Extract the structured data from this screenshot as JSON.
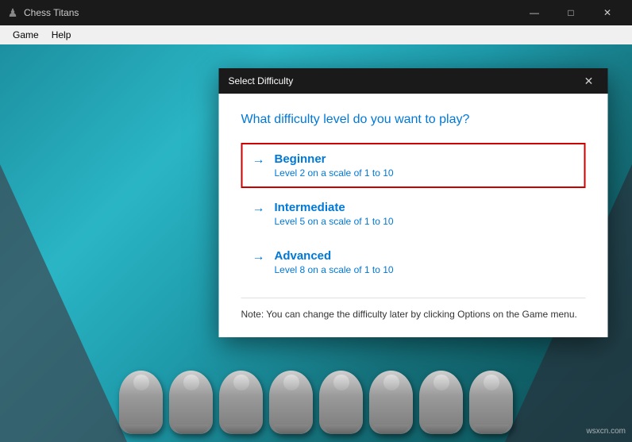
{
  "titleBar": {
    "icon": "♟",
    "title": "Chess Titans",
    "minimizeLabel": "—",
    "maximizeLabel": "□",
    "closeLabel": "✕"
  },
  "menuBar": {
    "items": [
      "Game",
      "Help"
    ]
  },
  "dialog": {
    "title": "Select Difficulty",
    "closeLabel": "✕",
    "question": "What difficulty level do you want to play?",
    "options": [
      {
        "name": "Beginner",
        "description": "Level 2 on a scale of 1 to 10",
        "selected": true
      },
      {
        "name": "Intermediate",
        "description": "Level 5 on a scale of 1 to 10",
        "selected": false
      },
      {
        "name": "Advanced",
        "description": "Level 8 on a scale of 1 to 10",
        "selected": false
      }
    ],
    "note": "Note: You can change the difficulty later by clicking Options on the Game menu."
  },
  "watermark": "wsxcn.com"
}
